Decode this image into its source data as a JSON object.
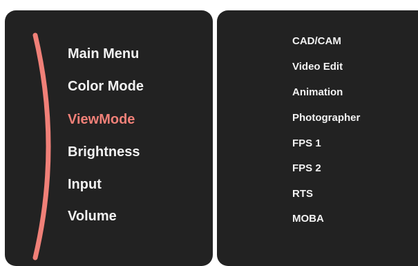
{
  "main_menu": {
    "items": [
      {
        "label": "Main Menu",
        "active": false
      },
      {
        "label": "Color Mode",
        "active": false
      },
      {
        "label": "ViewMode",
        "active": true
      },
      {
        "label": "Brightness",
        "active": false
      },
      {
        "label": "Input",
        "active": false
      },
      {
        "label": "Volume",
        "active": false
      }
    ]
  },
  "submenu": {
    "items": [
      {
        "label": "CAD/CAM"
      },
      {
        "label": "Video Edit"
      },
      {
        "label": "Animation"
      },
      {
        "label": "Photographer"
      },
      {
        "label": "FPS 1"
      },
      {
        "label": "FPS 2"
      },
      {
        "label": "RTS"
      },
      {
        "label": "MOBA"
      }
    ]
  },
  "colors": {
    "panel_background": "#222222",
    "text": "#f2f2f2",
    "accent": "#f08078"
  }
}
